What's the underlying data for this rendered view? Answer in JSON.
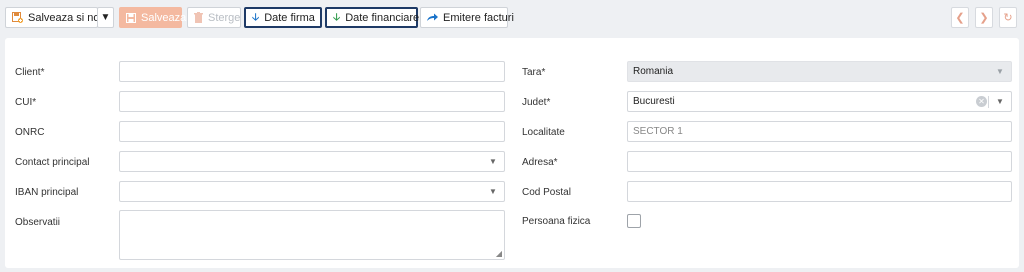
{
  "toolbar": {
    "save_new_label": "Salveaza si nou",
    "save_label": "Salveaza",
    "delete_label": "Sterge",
    "company_data_label": "Date firma",
    "financial_data_label": "Date financiare",
    "invoice_issue_label": "Emitere facturi"
  },
  "form": {
    "client": {
      "label": "Client*",
      "value": ""
    },
    "cui": {
      "label": "CUI*",
      "value": ""
    },
    "onrc": {
      "label": "ONRC",
      "value": ""
    },
    "contact": {
      "label": "Contact principal",
      "value": ""
    },
    "iban": {
      "label": "IBAN principal",
      "value": ""
    },
    "observations": {
      "label": "Observatii",
      "value": ""
    },
    "country": {
      "label": "Tara*",
      "value": "Romania"
    },
    "county": {
      "label": "Judet*",
      "value": "Bucuresti"
    },
    "locality": {
      "label": "Localitate",
      "placeholder": "SECTOR 1"
    },
    "address": {
      "label": "Adresa*",
      "value": ""
    },
    "postal_code": {
      "label": "Cod Postal",
      "value": ""
    },
    "individual": {
      "label": "Persoana fizica",
      "checked": false
    }
  },
  "colors": {
    "accent": "#f08a5d",
    "primary_blue": "#1a73c9",
    "border_highlight": "#1e3a66",
    "success_green": "#2e9a4b"
  },
  "icons": [
    "save-new-icon",
    "save-icon",
    "trash-icon",
    "arrow-down-icon",
    "share-arrow-icon",
    "chevron-left-icon",
    "chevron-right-icon",
    "refresh-icon"
  ]
}
